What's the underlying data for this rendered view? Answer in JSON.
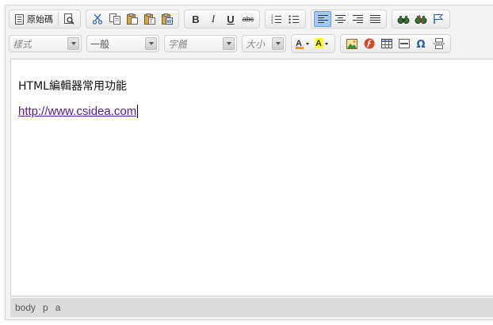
{
  "toolbar": {
    "source_label": "原始碼",
    "bold_label": "B",
    "italic_label": "I",
    "underline_label": "U",
    "strike_label": "abc",
    "style_combo": "樣式",
    "format_combo": "一般",
    "font_combo": "字體",
    "size_combo": "大小",
    "active_align": "left",
    "active_color": "#a4c7f5"
  },
  "content": {
    "paragraph": "HTML編輯器常用功能",
    "link_text": "http://www.csidea.com",
    "link_color": "#551a8b"
  },
  "statusbar": {
    "path": [
      "body",
      "p",
      "a"
    ]
  },
  "icons": [
    "source-icon",
    "preview-icon",
    "cut-icon",
    "copy-icon",
    "paste-icon",
    "paste-text-icon",
    "paste-word-icon",
    "numbered-list-icon",
    "bulleted-list-icon",
    "align-left-icon",
    "align-center-icon",
    "align-right-icon",
    "justify-icon",
    "link-icon",
    "unlink-icon",
    "anchor-icon",
    "text-color-icon",
    "background-color-icon",
    "image-icon",
    "flash-icon",
    "table-icon",
    "horizontal-rule-icon",
    "special-char-icon",
    "page-break-icon"
  ]
}
